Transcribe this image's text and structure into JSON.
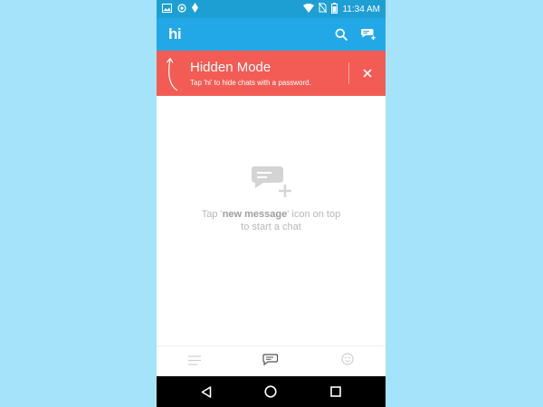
{
  "status_bar": {
    "time": "11:34 AM",
    "icons": [
      "image-icon",
      "location-icon",
      "diamond-icon",
      "wifi-icon",
      "no-sim-icon",
      "battery-icon"
    ]
  },
  "app_bar": {
    "logo": "hi",
    "color": "#22a8e6",
    "actions": [
      "search-icon",
      "new-message-icon"
    ]
  },
  "hidden_mode_banner": {
    "title": "Hidden Mode",
    "subtitle": "Tap 'hi' to hide chats with a password.",
    "color": "#f25c54"
  },
  "empty_state": {
    "icon": "new-chat-icon",
    "line1_prefix": "Tap '",
    "line1_highlight": "new message",
    "line1_suffix": "' icon on top",
    "line2": "to start a chat"
  },
  "bottom_tabs": [
    "menu-icon",
    "chats-icon",
    "smiley-icon"
  ],
  "nav_bar": [
    "back-icon",
    "home-icon",
    "recents-icon"
  ],
  "background_color": "#a5e3fa"
}
